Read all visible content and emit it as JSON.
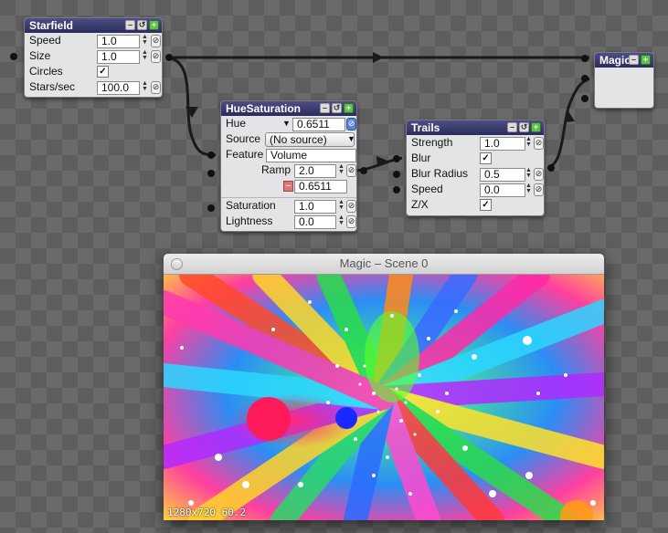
{
  "starfield": {
    "title": "Starfield",
    "rows": [
      {
        "label": "Speed",
        "value": "1.0"
      },
      {
        "label": "Size",
        "value": "1.0"
      },
      {
        "label": "Circles",
        "checked": true
      },
      {
        "label": "Stars/sec",
        "value": "100.0"
      }
    ]
  },
  "hue": {
    "title": "HueSaturation",
    "hue_label": "Hue",
    "hue_value": "0.6511",
    "source_label": "Source",
    "source_value": "(No source)",
    "feature_label": "Feature",
    "feature_value": "Volume",
    "ramp_label": "Ramp",
    "ramp_value": "2.0",
    "ramp_out": "0.6511",
    "saturation_label": "Saturation",
    "saturation_value": "1.0",
    "lightness_label": "Lightness",
    "lightness_value": "0.0"
  },
  "trails": {
    "title": "Trails",
    "rows": [
      {
        "label": "Strength",
        "value": "1.0"
      },
      {
        "label": "Blur",
        "checked": true
      },
      {
        "label": "Blur Radius",
        "value": "0.5"
      },
      {
        "label": "Speed",
        "value": "0.0"
      },
      {
        "label": "Z/X",
        "checked": true
      }
    ]
  },
  "magic": {
    "title": "Magic"
  },
  "window": {
    "title": "Magic – Scene 0",
    "stats": "1280x720 60.2"
  },
  "colors": {
    "title_bar": "#3a3a70",
    "link_active": "#5a84d8",
    "toggle_on": "#5ec24a"
  }
}
